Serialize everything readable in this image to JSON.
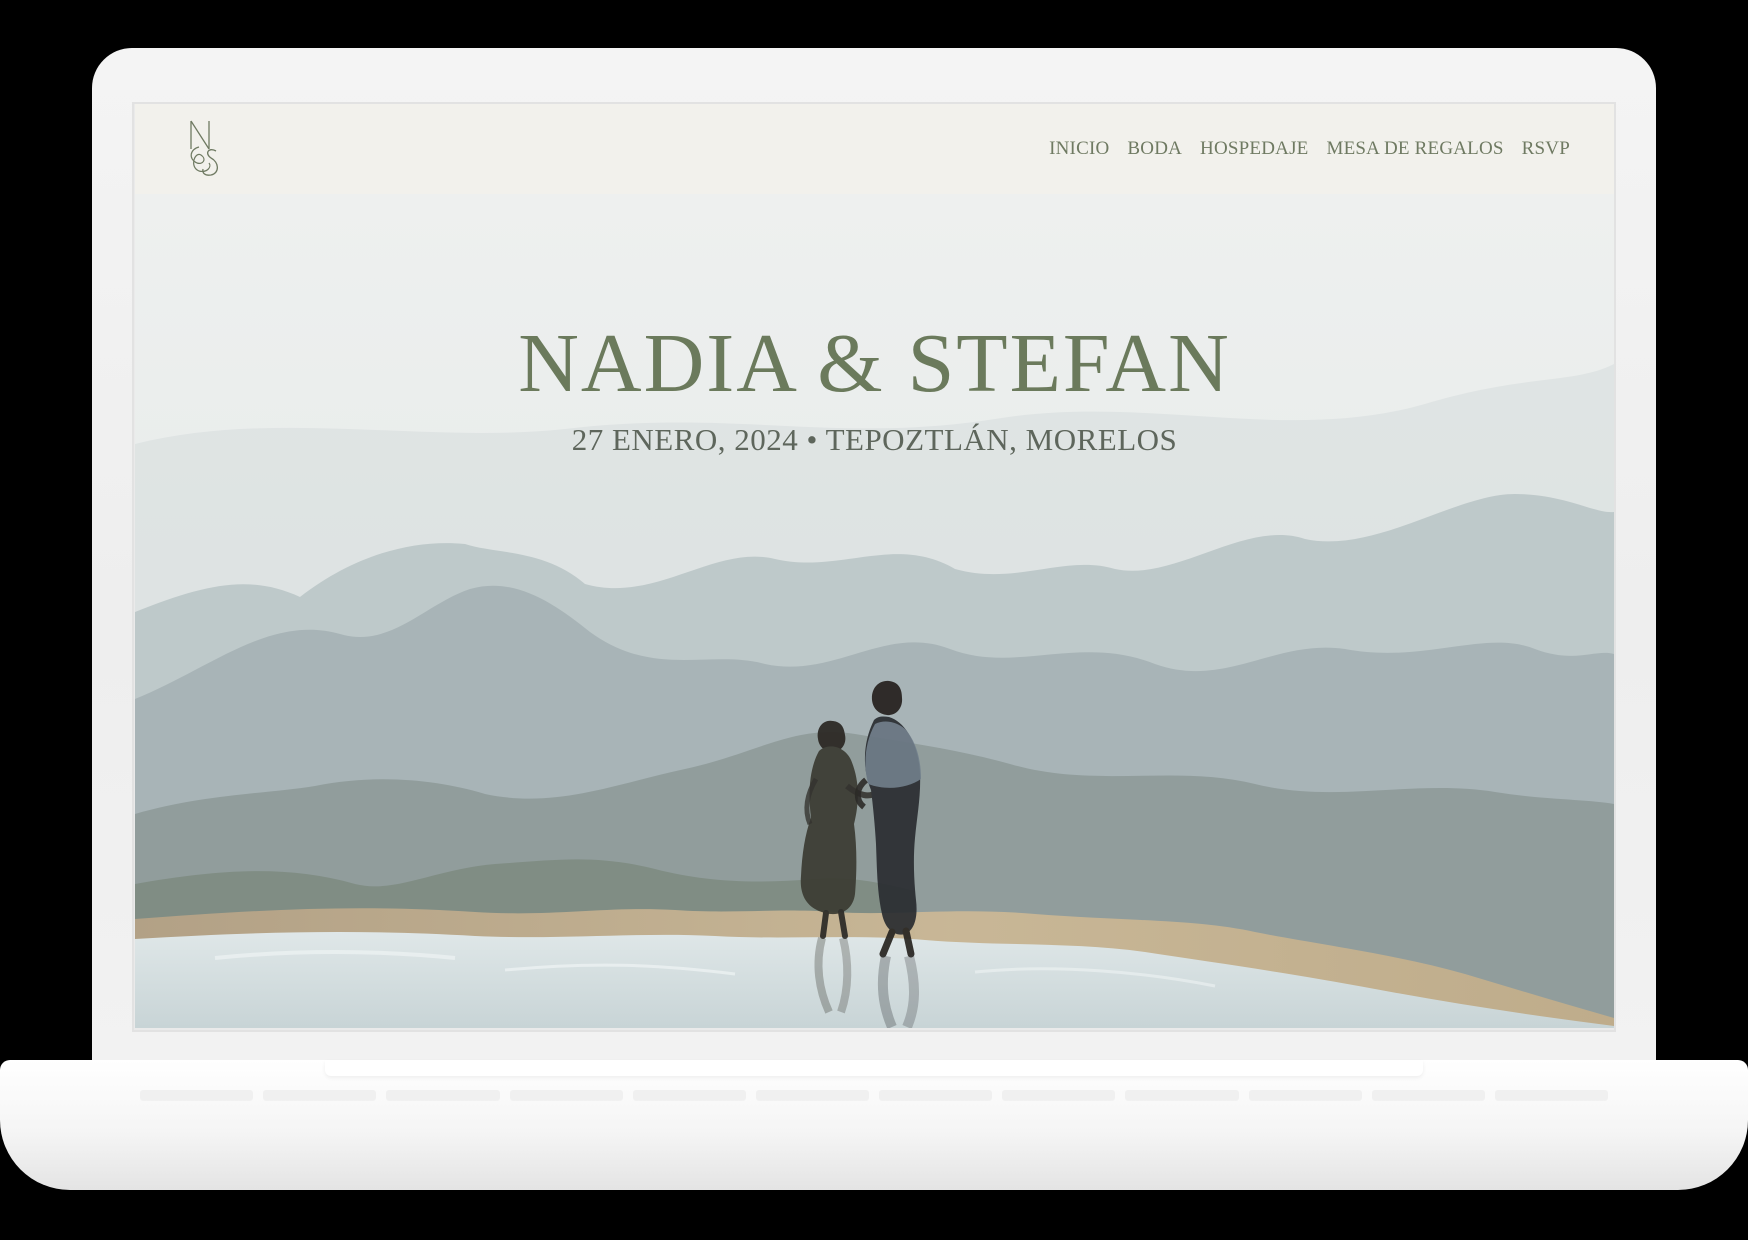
{
  "site": {
    "monogram": {
      "letters": [
        "N",
        "&",
        "S"
      ]
    },
    "nav": {
      "items": [
        {
          "label": "INICIO"
        },
        {
          "label": "BODA"
        },
        {
          "label": "HOSPEDAJE"
        },
        {
          "label": "MESA DE REGALOS"
        },
        {
          "label": "RSVP"
        }
      ]
    },
    "hero": {
      "title": "NADIA & STEFAN",
      "subtitle": "27 ENERO, 2024 • TEPOZTLÁN, MORELOS"
    }
  },
  "colors": {
    "header_bg": "#f2f1ec",
    "brand_green": "#6b7a5c",
    "text_muted": "#5e665c",
    "device_shell": "#f2f2f2"
  }
}
